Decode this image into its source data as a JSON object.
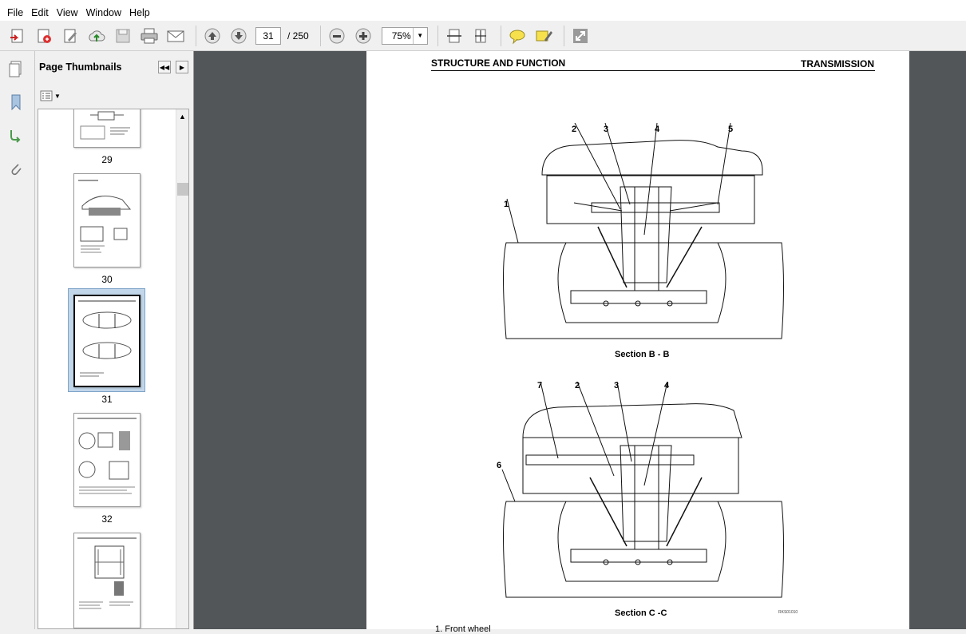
{
  "menu": [
    "File",
    "Edit",
    "View",
    "Window",
    "Help"
  ],
  "toolbar": {
    "current_page": "31",
    "page_total": "/ 250",
    "zoom": "75%",
    "icons": [
      "create-icon",
      "convert-icon",
      "edit-icon",
      "upload-icon",
      "save-icon",
      "print-icon",
      "email-icon",
      "prev-page-icon",
      "next-page-icon",
      "zoom-out-icon",
      "zoom-in-icon",
      "fit-width-icon",
      "fit-page-icon",
      "comment-icon",
      "highlight-icon",
      "expand-icon"
    ]
  },
  "sidebar": {
    "title": "Page Thumbnails",
    "thumbnails": [
      {
        "label": "29"
      },
      {
        "label": "30"
      },
      {
        "label": "31",
        "selected": true
      },
      {
        "label": "32"
      },
      {
        "label": ""
      }
    ]
  },
  "document": {
    "header_left": "STRUCTURE AND FUNCTION",
    "header_right": "TRANSMISSION",
    "section1": {
      "caption": "Section B - B",
      "callouts": [
        "1",
        "2",
        "3",
        "4",
        "5"
      ]
    },
    "section2": {
      "caption": "Section C -C",
      "callouts": [
        "6",
        "7",
        "2",
        "3",
        "4"
      ]
    },
    "figure_code": "RKS01010",
    "bottom_text": "1.  Front wheel"
  }
}
